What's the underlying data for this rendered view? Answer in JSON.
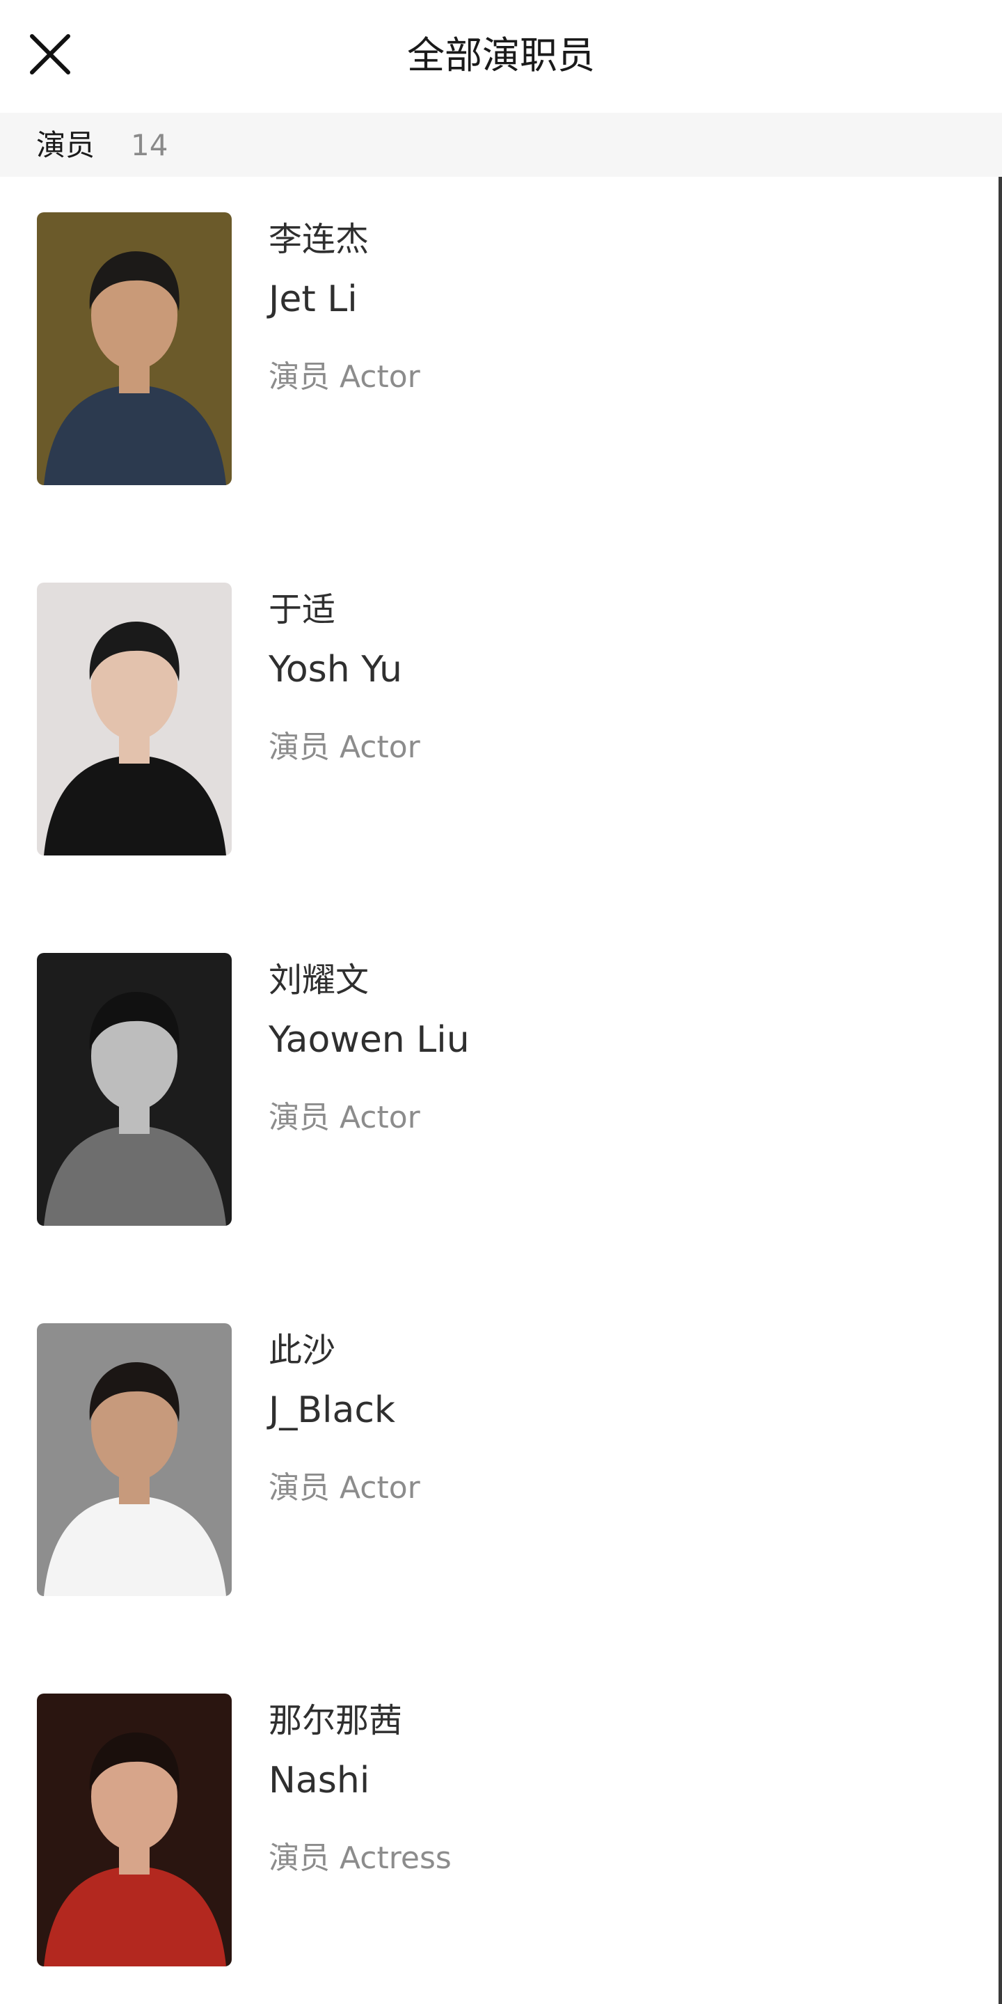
{
  "header": {
    "title": "全部演职员",
    "close_icon": "close-icon"
  },
  "section": {
    "label": "演员",
    "count": "14"
  },
  "cast": [
    {
      "name_cn": "李连杰",
      "name_en": "Jet Li",
      "role": "演员 Actor",
      "bg": "#6b5a2a",
      "suit": "#2c3a4f",
      "skin": "#c99a78",
      "hair": "#1c1a18"
    },
    {
      "name_cn": "于适",
      "name_en": "Yosh Yu",
      "role": "演员 Actor",
      "bg": "#e2dedd",
      "suit": "#141414",
      "skin": "#e3c2ad",
      "hair": "#1a1a1a"
    },
    {
      "name_cn": "刘耀文",
      "name_en": "Yaowen Liu",
      "role": "演员 Actor",
      "bg": "#1c1c1c",
      "suit": "#6e6e6e",
      "skin": "#bdbdbd",
      "hair": "#111111"
    },
    {
      "name_cn": "此沙",
      "name_en": "J_Black",
      "role": "演员 Actor",
      "bg": "#8e8e8e",
      "suit": "#f4f4f4",
      "skin": "#c79a7c",
      "hair": "#1b1614"
    },
    {
      "name_cn": "那尔那茜",
      "name_en": "Nashi",
      "role": "演员 Actress",
      "bg": "#2a1510",
      "suit": "#b3281f",
      "skin": "#d7a58a",
      "hair": "#1a0f0c"
    }
  ]
}
